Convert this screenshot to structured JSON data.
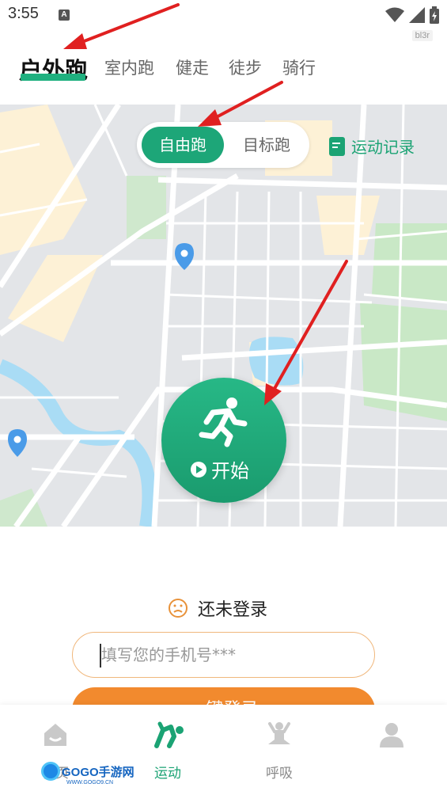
{
  "status_bar": {
    "time": "3:55",
    "notification_letter": "A",
    "icons": [
      "wifi-icon",
      "signal-icon",
      "battery-icon"
    ],
    "tag": "bl3r"
  },
  "top_tabs": {
    "items": [
      {
        "label": "户外跑",
        "active": true
      },
      {
        "label": "室内跑",
        "active": false
      },
      {
        "label": "健走",
        "active": false
      },
      {
        "label": "徒步",
        "active": false
      },
      {
        "label": "骑行",
        "active": false
      }
    ]
  },
  "map_panel": {
    "modes": {
      "free": "自由跑",
      "target": "目标跑",
      "selected": "自由跑"
    },
    "records_label": "运动记录",
    "start_label": "开始"
  },
  "login": {
    "status_text": "还未登录",
    "phone_placeholder": "填写您的手机号***",
    "button_label": "一键登录"
  },
  "bottom_nav": {
    "items": [
      {
        "label": "首页",
        "icon": "home-icon",
        "active": false
      },
      {
        "label": "运动",
        "icon": "sport-icon",
        "active": true
      },
      {
        "label": "呼吸",
        "icon": "meditation-icon",
        "active": false
      },
      {
        "label": "",
        "icon": "profile-icon",
        "active": false
      }
    ]
  },
  "watermark": {
    "name": "GOGO手游网",
    "url": "WWW.GOGO9.CN"
  },
  "colors": {
    "accent_green": "#1da678",
    "login_orange": "#f28a2e",
    "annotation_red": "#e02020"
  }
}
